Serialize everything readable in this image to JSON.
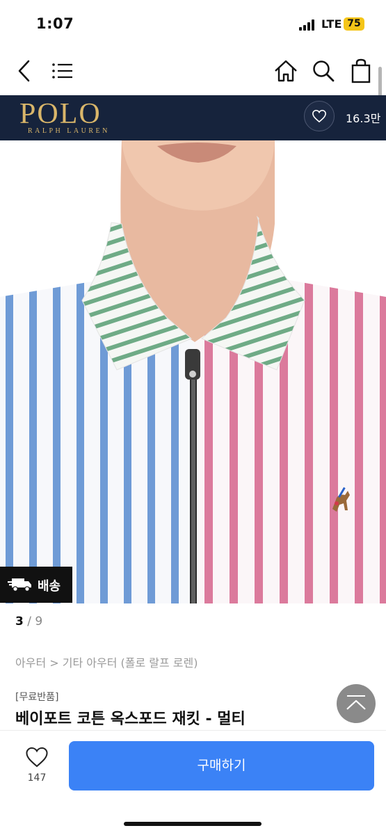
{
  "status_bar": {
    "time": "1:07",
    "network": "LTE",
    "battery": "75"
  },
  "nav": {
    "icons": [
      "back-icon",
      "menu-icon",
      "home-icon",
      "search-icon",
      "shopping-bag-icon"
    ]
  },
  "brand": {
    "logo_main": "POLO",
    "logo_sub": "RALPH LAUREN",
    "like_count": "16.3만"
  },
  "badge": {
    "delivery_label": "배송",
    "icon": "delivery-truck-icon"
  },
  "pager": {
    "current": "3",
    "total": "9",
    "separator": "/"
  },
  "product": {
    "breadcrumb": "아우터 > 기타 아우터 (폴로 랄프 로렌)",
    "tag": "[무료반품]",
    "title": "베이포트 코튼 옥스포드 재킷 - 멀티"
  },
  "bottom_bar": {
    "wish_count": "147",
    "buy_label": "구매하기"
  },
  "colors": {
    "brand_bg": "#16233c",
    "brand_gold": "#d9b66a",
    "buy_blue": "#3b82f6",
    "battery": "#f5c518"
  }
}
